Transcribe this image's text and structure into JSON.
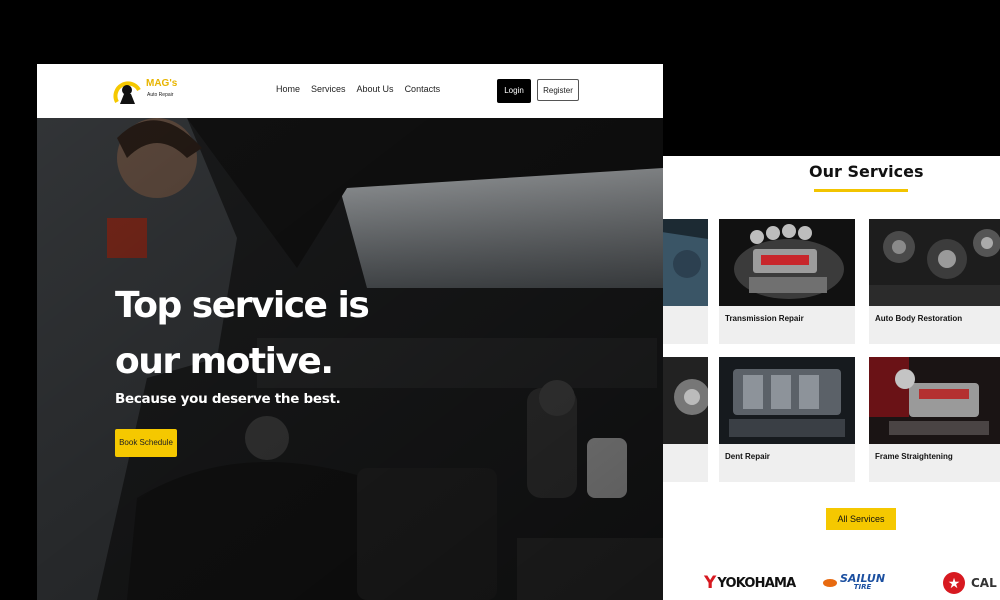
{
  "navbar": {
    "logo": {
      "name": "MAG's",
      "tagline": "Auto Repair"
    },
    "links": [
      {
        "label": "Home"
      },
      {
        "label": "Services"
      },
      {
        "label": "About Us"
      },
      {
        "label": "Contacts"
      }
    ],
    "login_label": "Login",
    "register_label": "Register"
  },
  "hero": {
    "title": "Top service is our motive.",
    "subtitle": "Because you deserve the best.",
    "cta_label": "Book Schedule"
  },
  "services_section": {
    "title": "Our Services",
    "cards": [
      {
        "label": ""
      },
      {
        "label": "Transmission Repair"
      },
      {
        "label": "Auto Body Restoration"
      },
      {
        "label": ""
      },
      {
        "label": "Dent Repair"
      },
      {
        "label": "Frame Straightening"
      }
    ],
    "all_services_label": "All Services"
  },
  "brands": [
    {
      "name": "YOKOHAMA"
    },
    {
      "name": "SAILUN",
      "sub": "TIRE"
    },
    {
      "name": "CAL"
    }
  ],
  "colors": {
    "accent": "#f5c800",
    "brand_red": "#d71920",
    "sailun_blue": "#1b4fa0"
  }
}
